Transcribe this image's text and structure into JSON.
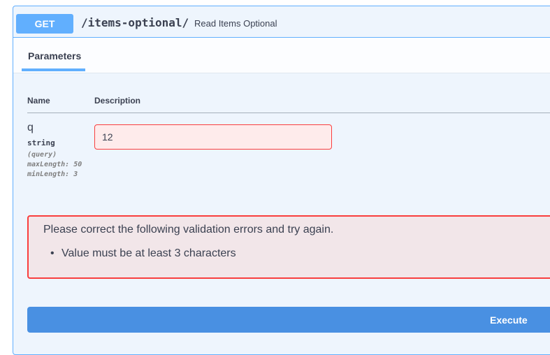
{
  "operation": {
    "method": "GET",
    "path": "/items-optional/",
    "summary": "Read Items Optional"
  },
  "parameters_section": {
    "tab_label": "Parameters",
    "col_name": "Name",
    "col_description": "Description"
  },
  "parameter": {
    "name": "q",
    "type": "string",
    "in": "(query)",
    "max_length": "maxLength: 50",
    "min_length": "minLength: 3",
    "value": "12"
  },
  "validation": {
    "message": "Please correct the following validation errors and try again.",
    "errors": [
      "Value must be at least 3 characters"
    ]
  },
  "actions": {
    "execute_label": "Execute"
  },
  "colors": {
    "get_accent": "#61affe",
    "error_border": "#f93e3e",
    "execute_bg": "#4990e2"
  }
}
